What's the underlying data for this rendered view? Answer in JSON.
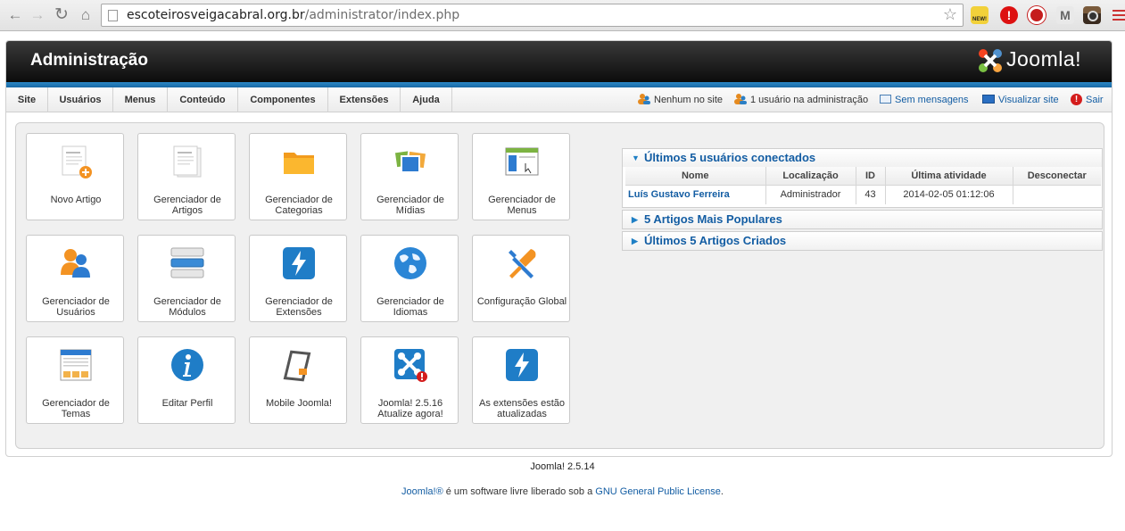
{
  "browser": {
    "url_host": "escoteirosveigacabral.org.br",
    "url_path": "/administrator/index.php",
    "ext_new_label": "NEW!"
  },
  "header": {
    "title": "Administração",
    "logo_text": "Joomla!"
  },
  "menu": [
    "Site",
    "Usuários",
    "Menus",
    "Conteúdo",
    "Componentes",
    "Extensões",
    "Ajuda"
  ],
  "status": {
    "site": "Nenhum no site",
    "admin": "1 usuário na administração",
    "messages": "Sem mensagens",
    "view_site": "Visualizar site",
    "logout": "Sair"
  },
  "tiles": [
    {
      "label": "Novo Artigo",
      "icon": "new-article-icon"
    },
    {
      "label": "Gerenciador de Artigos",
      "icon": "articles-icon"
    },
    {
      "label": "Gerenciador de Categorias",
      "icon": "folder-icon"
    },
    {
      "label": "Gerenciador de Mídias",
      "icon": "media-icon"
    },
    {
      "label": "Gerenciador de Menus",
      "icon": "menus-icon"
    },
    {
      "label": "Gerenciador de Usuários",
      "icon": "users-icon"
    },
    {
      "label": "Gerenciador de Módulos",
      "icon": "modules-icon"
    },
    {
      "label": "Gerenciador de Extensões",
      "icon": "extensions-icon"
    },
    {
      "label": "Gerenciador de Idiomas",
      "icon": "globe-icon"
    },
    {
      "label": "Configuração Global",
      "icon": "tools-icon"
    },
    {
      "label": "Gerenciador de Temas",
      "icon": "templates-icon"
    },
    {
      "label": "Editar Perfil",
      "icon": "info-icon"
    },
    {
      "label": "Mobile Joomla!",
      "icon": "mobile-icon"
    },
    {
      "label": "Joomla! 2.5.16 Atualize agora!",
      "icon": "joomla-update-icon"
    },
    {
      "label": "As extensões estão atualizadas",
      "icon": "extensions-updated-icon"
    }
  ],
  "widgets": {
    "logged_users": {
      "title": "Últimos 5 usuários conectados",
      "columns": [
        "Nome",
        "Localização",
        "ID",
        "Última atividade",
        "Desconectar"
      ],
      "rows": [
        [
          "Luís Gustavo Ferreira",
          "Administrador",
          "43",
          "2014-02-05 01:12:06",
          ""
        ]
      ]
    },
    "popular": {
      "title": "5 Artigos Mais Populares"
    },
    "latest": {
      "title": "Últimos 5 Artigos Criados"
    }
  },
  "footer": {
    "version": "Joomla! 2.5.14",
    "license_prefix": "Joomla!®",
    "license_middle": " é um software livre liberado sob a ",
    "license_link": "GNU General Public License",
    "license_suffix": "."
  },
  "colors": {
    "accent_blue": "#135da3",
    "header_dark": "#0c0c0c",
    "band_blue": "#2b87c6"
  }
}
